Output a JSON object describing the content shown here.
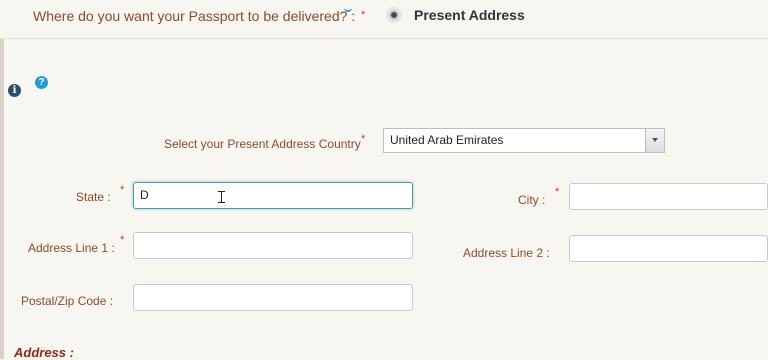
{
  "delivery": {
    "question": "Where do you want your Passport to be delivered? :",
    "required_mark": "*",
    "selected_option": "Present Address"
  },
  "icons": {
    "info": "info-icon",
    "help": "help-icon",
    "info_glyph": "i",
    "help_glyph": "?"
  },
  "country": {
    "label": "Select your Present Address Country",
    "required_mark": "*",
    "value": "United Arab Emirates"
  },
  "state": {
    "label": "State :",
    "required_mark": "*",
    "value": "D"
  },
  "city": {
    "label": "City :",
    "required_mark": "*",
    "value": ""
  },
  "address_line1": {
    "label": "Address Line 1 :",
    "required_mark": "*",
    "value": ""
  },
  "address_line2": {
    "label": "Address Line 2 :",
    "value": ""
  },
  "postal": {
    "label": "Postal/Zip Code :",
    "value": ""
  },
  "section": {
    "title": "Address :"
  },
  "colors": {
    "label": "#8b4a2a",
    "required": "#c0392b",
    "focus_border": "#4b9aa8",
    "background": "#f7f6f1"
  }
}
